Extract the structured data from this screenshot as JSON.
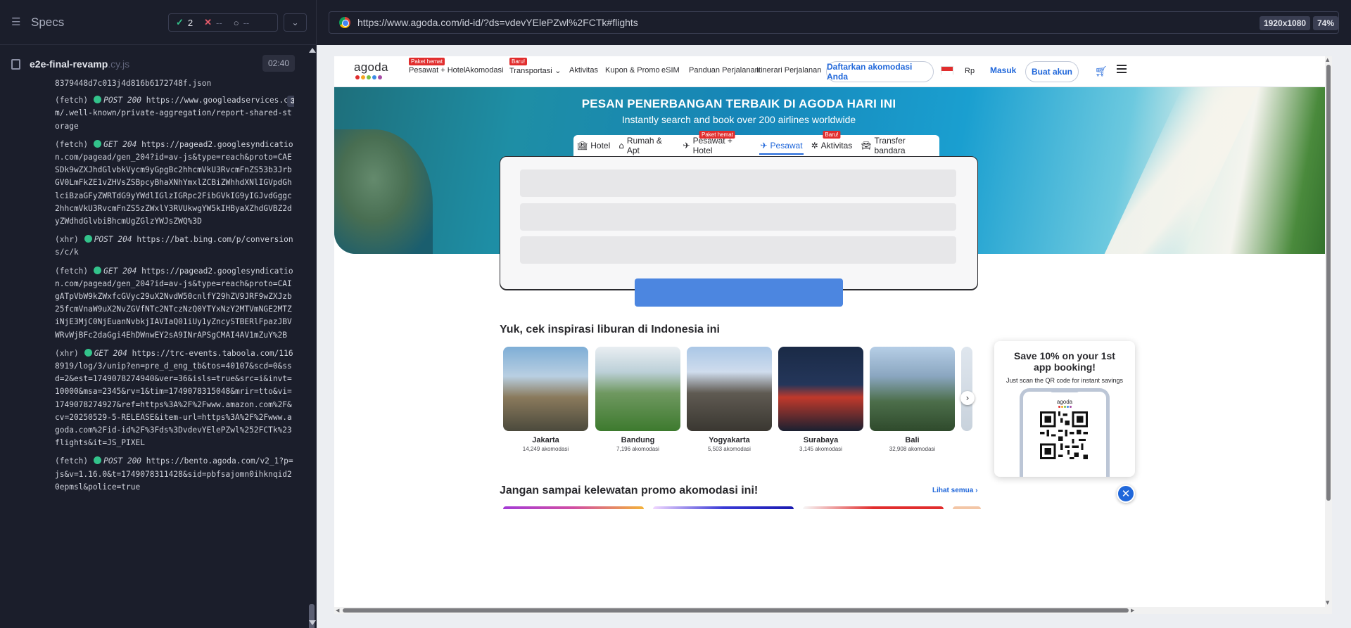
{
  "runner": {
    "panel_title": "Specs",
    "stats": {
      "passed": "2",
      "failed": "--",
      "pending": "--"
    },
    "file": {
      "name": "e2e-final-revamp",
      "ext": ".cy.js",
      "duration": "02:40"
    },
    "log_first_line": "8379448d7c013j4d816b6172748f.json",
    "log": [
      {
        "kind": "(fetch)",
        "status": "POST 200",
        "url": "https://www.googleadservices.com/.well-known/private-aggregation/report-shared-storage",
        "count": "3",
        "collapsible": true
      },
      {
        "kind": "(fetch)",
        "status": "GET 204",
        "url": "https://pagead2.googlesyndication.com/pagead/gen_204?id=av-js&type=reach&proto=CAESDk9wZXJhdGlvbkVycm9yGpgBc2hhcmVkU3RvcmFnZS53b3JrbGV0LmFkZE1vZHVsZSBpcyBhaXNhYmxlZCBiZWhhdXNlIGVpdGhlciBzaGFyZWRTdG9yYWdlIGlzIGRpc2FibGVkIG9yIGJvdGggc2hhcmVkU3RvcmFnZS5zZWxlY3RVUkwgYW5kIHByaXZhdGVBZ2dyZWdhdGlvbiBhcmUgZGlzYWJsZWQ%3D",
        "count": "",
        "collapsible": false
      },
      {
        "kind": "(xhr)",
        "status": "POST 204",
        "url": "https://bat.bing.com/p/conversions/c/k",
        "count": "",
        "collapsible": false
      },
      {
        "kind": "(fetch)",
        "status": "GET 204",
        "url": "https://pagead2.googlesyndication.com/pagead/gen_204?id=av-js&type=reach&proto=CAIgATpVbW9kZWxfcGVyc29uX2NvdW50cnlfY29hZV9JRF9wZXJzb25fcmVnaW9uX2NvZGVfNTc2NTczNzQ0YTYxNzY2MTVmNGE2MTZiNjE3MjC0NjEuanNvbkjIAVIaQ01iUy1yZncySTBERlFpazJBVWRvWjBFc2daGgi4EhDWnwEY2sA9INrAPSgCMAI4AV1mZuY%2B",
        "count": "",
        "collapsible": false
      },
      {
        "kind": "(xhr)",
        "status": "GET 204",
        "url": "https://trc-events.taboola.com/1168919/log/3/unip?en=pre_d_eng_tb&tos=40107&scd=0&ssd=2&est=1749078274940&ver=36&isls=true&src=i&invt=10000&msa=2345&rv=1&tim=1749078315048&mrir=tto&vi=1749078274927&ref=https%3A%2F%2Fwww.amazon.com%2F&cv=20250529-5-RELEASE&item-url=https%3A%2F%2Fwww.agoda.com%2Fid-id%2F%3Fds%3DvdevYElePZwl%252FCTk%23flights&it=JS_PIXEL",
        "count": "",
        "collapsible": false
      },
      {
        "kind": "(fetch)",
        "status": "POST 200",
        "url": "https://bento.agoda.com/v2_1?p=js&v=1.16.0&t=1749078311428&sid=pbfsajomn0ihknqid20epmsl&police=true",
        "count": "",
        "collapsible": false
      }
    ]
  },
  "browser": {
    "url": "https://www.agoda.com/id-id/?ds=vdevYElePZwl%2FCTk#flights",
    "resolution": "1920x1080",
    "zoom": "74%"
  },
  "agoda": {
    "logo": "agoda",
    "logo_dot_colors": [
      "#e12d2d",
      "#f5a623",
      "#7ac143",
      "#3d8be4",
      "#a64ca6"
    ],
    "nav": [
      {
        "label": "Pesawat + Hotel",
        "tag": "Paket hemat"
      },
      {
        "label": "Akomodasi",
        "tag": ""
      },
      {
        "label": "Transportasi",
        "tag": "Baru!"
      },
      {
        "label": "Aktivitas",
        "tag": ""
      },
      {
        "label": "Kupon & Promo",
        "tag": ""
      },
      {
        "label": "eSIM",
        "tag": ""
      },
      {
        "label": "Panduan Perjalanan",
        "tag": ""
      },
      {
        "label": "Itinerari Perjalanan",
        "tag": ""
      }
    ],
    "list_property": "Daftarkan akomodasi Anda",
    "currency": "Rp",
    "login": "Masuk",
    "signup": "Buat akun",
    "hero": {
      "title": "PESAN PENERBANGAN TERBAIK DI AGODA HARI INI",
      "subtitle": "Instantly search and book over 200 airlines worldwide"
    },
    "tabs": [
      {
        "label": "Hotel",
        "icon": "hotel-icon",
        "tag": ""
      },
      {
        "label": "Rumah & Apt",
        "icon": "home-icon",
        "tag": ""
      },
      {
        "label": "Pesawat + Hotel",
        "icon": "flight-hotel-icon",
        "tag": "Paket hemat"
      },
      {
        "label": "Pesawat",
        "icon": "plane-icon",
        "tag": ""
      },
      {
        "label": "Aktivitas",
        "icon": "activities-icon",
        "tag": "Baru!"
      },
      {
        "label": "Transfer bandara",
        "icon": "car-icon",
        "tag": ""
      }
    ],
    "active_tab": "Pesawat",
    "inspiration_title": "Yuk, cek inspirasi liburan di Indonesia ini",
    "destinations": [
      {
        "name": "Jakarta",
        "count": "14,249 akomodasi"
      },
      {
        "name": "Bandung",
        "count": "7,196 akomodasi"
      },
      {
        "name": "Yogyakarta",
        "count": "5,503 akomodasi"
      },
      {
        "name": "Surabaya",
        "count": "3,145 akomodasi"
      },
      {
        "name": "Bali",
        "count": "32,908 akomodasi"
      }
    ],
    "promo_title": "Jangan sampai kelewatan promo akomodasi ini!",
    "see_all": "Lihat semua",
    "app_promo": {
      "title": "Save 10% on your 1st app booking!",
      "subtitle": "Just scan the QR code for instant savings",
      "logo": "agoda"
    },
    "accent_color": "#2067da"
  }
}
